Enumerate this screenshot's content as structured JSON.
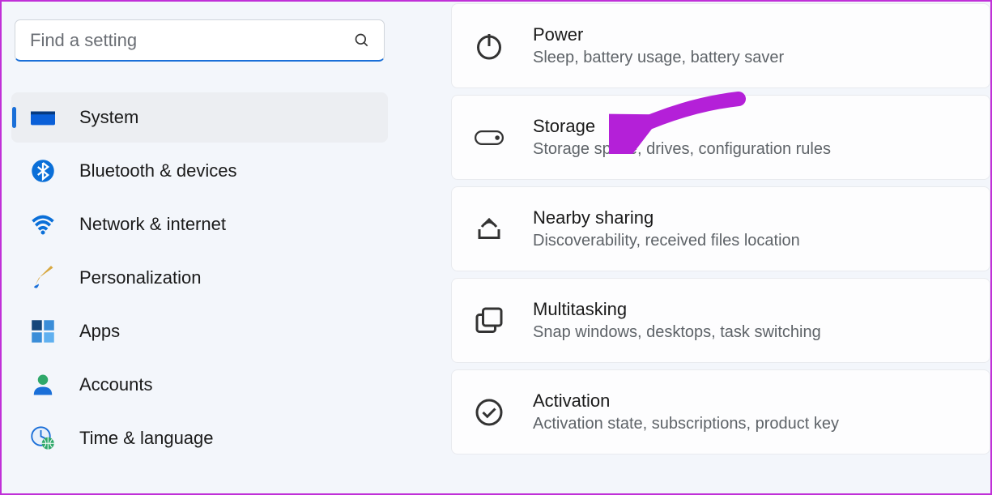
{
  "search": {
    "placeholder": "Find a setting"
  },
  "sidebar": {
    "items": [
      {
        "label": "System",
        "icon": "display-icon",
        "active": true
      },
      {
        "label": "Bluetooth & devices",
        "icon": "bluetooth-icon",
        "active": false
      },
      {
        "label": "Network & internet",
        "icon": "wifi-icon",
        "active": false
      },
      {
        "label": "Personalization",
        "icon": "brush-icon",
        "active": false
      },
      {
        "label": "Apps",
        "icon": "apps-icon",
        "active": false
      },
      {
        "label": "Accounts",
        "icon": "person-icon",
        "active": false
      },
      {
        "label": "Time & language",
        "icon": "clock-globe-icon",
        "active": false
      }
    ]
  },
  "main": {
    "cards": [
      {
        "title": "Power",
        "subtitle": "Sleep, battery usage, battery saver",
        "icon": "power-icon"
      },
      {
        "title": "Storage",
        "subtitle": "Storage space, drives, configuration rules",
        "icon": "drive-icon"
      },
      {
        "title": "Nearby sharing",
        "subtitle": "Discoverability, received files location",
        "icon": "share-icon"
      },
      {
        "title": "Multitasking",
        "subtitle": "Snap windows, desktops, task switching",
        "icon": "windows-icon"
      },
      {
        "title": "Activation",
        "subtitle": "Activation state, subscriptions, product key",
        "icon": "check-circle-icon"
      }
    ]
  },
  "annotation": {
    "arrow_color": "#b420d8"
  }
}
